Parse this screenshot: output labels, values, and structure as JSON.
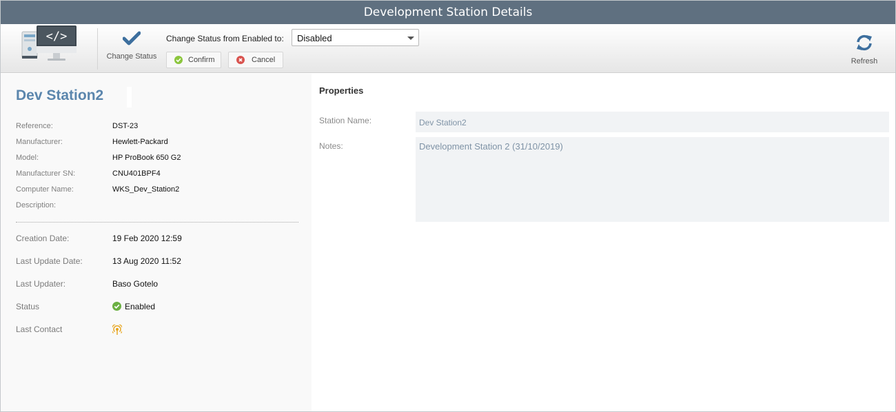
{
  "window": {
    "title": "Development Station Details"
  },
  "toolbar": {
    "app_icon": "development-station-icon",
    "change_status": {
      "icon": "checkmark-icon",
      "label": "Change Status"
    },
    "status_prompt": "Change Status from Enabled to:",
    "status_select": {
      "value": "Disabled"
    },
    "confirm": {
      "icon": "confirm-check-icon",
      "label": "Confirm"
    },
    "cancel": {
      "icon": "cancel-x-icon",
      "label": "Cancel"
    },
    "refresh": {
      "icon": "refresh-icon",
      "label": "Refresh"
    }
  },
  "station": {
    "name": "Dev Station2",
    "details": [
      {
        "label": "Reference:",
        "value": "DST-23"
      },
      {
        "label": "Manufacturer:",
        "value": "Hewlett-Packard"
      },
      {
        "label": "Model:",
        "value": "HP ProBook 650 G2"
      },
      {
        "label": "Manufacturer SN:",
        "value": "CNU401BPF4"
      },
      {
        "label": "Computer Name:",
        "value": "WKS_Dev_Station2"
      },
      {
        "label": "Description:",
        "value": ""
      }
    ],
    "meta": [
      {
        "label": "Creation Date:",
        "value": "19 Feb 2020 12:59"
      },
      {
        "label": "Last Update Date:",
        "value": "13 Aug 2020 11:52"
      },
      {
        "label": "Last Updater:",
        "value": "Baso Gotelo"
      },
      {
        "label": "Status",
        "value": "Enabled"
      },
      {
        "label": "Last Contact",
        "value": ""
      }
    ],
    "status_icon": "enabled-check-icon",
    "last_contact_icon": "signal-icon"
  },
  "properties": {
    "title": "Properties",
    "station_name_label": "Station Name:",
    "station_name_value": "Dev Station2",
    "notes_label": "Notes:",
    "notes_value": "Development Station 2 (31/10/2019)"
  },
  "colors": {
    "titlebar": "#5f7080",
    "station_name": "#5b86ad",
    "accent_blue": "#3d6f9e",
    "confirm_green": "#8cc63e",
    "cancel_red": "#d9534f",
    "status_green": "#6bb043",
    "signal_orange": "#e7a41c"
  }
}
